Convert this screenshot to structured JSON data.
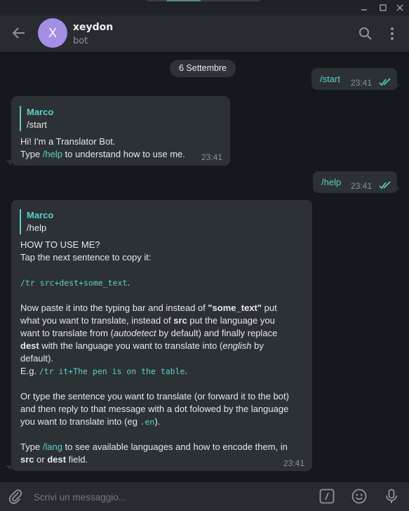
{
  "header": {
    "avatar_letter": "X",
    "chat_name": "xeydon",
    "chat_status": "bot"
  },
  "chat": {
    "date_label": "6 Settembre",
    "messages": [
      {
        "dir": "out",
        "text": "/start",
        "time": "23:41"
      },
      {
        "dir": "in",
        "reply_author": "Marco",
        "reply_text": "/start",
        "line1": "Hi! I'm a Translator Bot.",
        "line2_pre": "Type ",
        "line2_cmd": "/help",
        "line2_post": " to understand how to use me.",
        "time": "23:41"
      },
      {
        "dir": "out",
        "text": "/help",
        "time": "23:41"
      },
      {
        "dir": "in",
        "reply_author": "Marco",
        "reply_text": "/help",
        "p1_l1": "HOW TO USE ME?",
        "p1_l2": "Tap the next sentence to copy it:",
        "code1": "/tr src+dest+some_text",
        "code1_dot": ".",
        "p2_a": "Now paste it into the typing bar and instead of ",
        "p2_b": "\"some_text\"",
        "p2_c": " put",
        "p2_l2": "what you want to translate, instead of ",
        "p2_l2b": "src",
        "p2_l2c": " put the language you",
        "p2_l3a": "want to translate from (",
        "p2_l3b": "autodetect",
        "p2_l3c": " by default) and finally replace",
        "p2_l4a": "dest",
        "p2_l4b": " with the language you want to translate into (",
        "p2_l4c": "english",
        "p2_l4d": " by",
        "p2_l5": "default).",
        "eg_pre": "E.g. ",
        "eg_code": "/tr it+The pen is on the table",
        "eg_post": ".",
        "p3_l1": "Or type the sentence you want to translate (or forward it to the bot)",
        "p3_l2": "and then reply to that message with a dot folowed by the language",
        "p3_l3a": "you want to translate into (eg ",
        "p3_l3b": ".en",
        "p3_l3c": ").",
        "p4_l1a": "Type ",
        "p4_l1b": "/lang",
        "p4_l1c": " to see available languages and how to encode them, in",
        "p4_l2a": "src",
        "p4_l2b": " or ",
        "p4_l2c": "dest",
        "p4_l2d": " field.",
        "time": "23:41"
      }
    ]
  },
  "composer": {
    "placeholder": "Scrivi un messaggio..."
  },
  "icons": {
    "back": "arrow-left-icon",
    "search": "search-icon",
    "menu": "more-vertical-icon",
    "attach": "paperclip-icon",
    "commands": "slash-command-icon",
    "emoji": "emoji-icon",
    "mic": "microphone-icon"
  },
  "colors": {
    "accent": "#5bd1c3",
    "avatar": "#a48ee6",
    "bubble": "#2c3136",
    "background": "#15181c"
  }
}
